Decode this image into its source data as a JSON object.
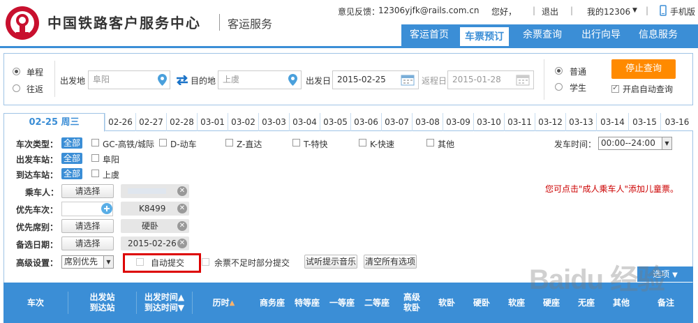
{
  "header": {
    "brand": "中国铁路客户服务中心",
    "sub_brand": "客运服务",
    "feedback_label": "意见反馈：",
    "feedback_email": "12306yjfk@rails.com.cn",
    "greeting": "您好，",
    "separator": "|",
    "logout": "退出",
    "my12306": "我的12306",
    "mobile": "手机版",
    "nav": [
      "客运首页",
      "车票预订",
      "余票查询",
      "出行向导",
      "信息服务"
    ]
  },
  "query": {
    "trip_single": "单程",
    "trip_round": "往返",
    "from_label": "出发地",
    "from_value": "阜阳",
    "to_label": "目的地",
    "to_value": "上虞",
    "depart_label": "出发日",
    "depart_value": "2015-02-25",
    "return_label": "返程日",
    "return_value": "2015-01-28",
    "type_normal": "普通",
    "type_student": "学生",
    "stop_button": "停止查询",
    "auto_query": "开启自动查询"
  },
  "date_tabs": [
    "02-25 周三",
    "02-26",
    "02-27",
    "02-28",
    "03-01",
    "03-02",
    "03-03",
    "03-04",
    "03-05",
    "03-06",
    "03-07",
    "03-08",
    "03-09",
    "03-10",
    "03-11",
    "03-12",
    "03-13",
    "03-14",
    "03-15",
    "03-16"
  ],
  "filters": {
    "train_type_label": "车次类型：",
    "all": "全部",
    "train_types": [
      "GC-高铁/城际",
      "D-动车",
      "Z-直达",
      "T-特快",
      "K-快速",
      "其他"
    ],
    "depart_time_label": "发车时间：",
    "depart_time_value": "00:00--24:00",
    "from_station_label": "出发车站：",
    "from_station": "阜阳",
    "to_station_label": "到达车站：",
    "to_station": "上虞",
    "passenger_label": "乘车人：",
    "select_btn": "请选择",
    "priority_train_label": "优先车次：",
    "priority_train_value": "K8499",
    "priority_seat_label": "优先席别：",
    "priority_seat_value": "硬卧",
    "alt_date_label": "备选日期：",
    "alt_date_value": "2015-02-26",
    "advanced_label": "高级设置：",
    "advanced_value": "席别优先",
    "auto_submit": "自动提交",
    "partial_submit": "余票不足时部分提交",
    "test_music": "试听提示音乐",
    "clear_all": "清空所有选项",
    "child_note": "您可点击\"成人乘车人\"添加儿童票。",
    "more_options": "选项"
  },
  "result_header": {
    "train": "车次",
    "from_station": "出发站",
    "to_station": "到达站",
    "depart_time": "出发时间",
    "arrive_time": "到达时间",
    "duration": "历时",
    "business": "商务座",
    "special": "特等座",
    "first": "一等座",
    "second": "二等座",
    "hsoft_1": "高级",
    "hsoft_2": "软卧",
    "soft_sleeper": "软卧",
    "hard_sleeper": "硬卧",
    "soft_seat": "软座",
    "hard_seat": "硬座",
    "no_seat": "无座",
    "other": "其他",
    "remark": "备注"
  },
  "watermark": "Baidu 经验",
  "colors": {
    "primary": "#3b8ed6",
    "accent": "#ff8a00",
    "alert": "#cc0000",
    "logo": "#c8102e"
  }
}
